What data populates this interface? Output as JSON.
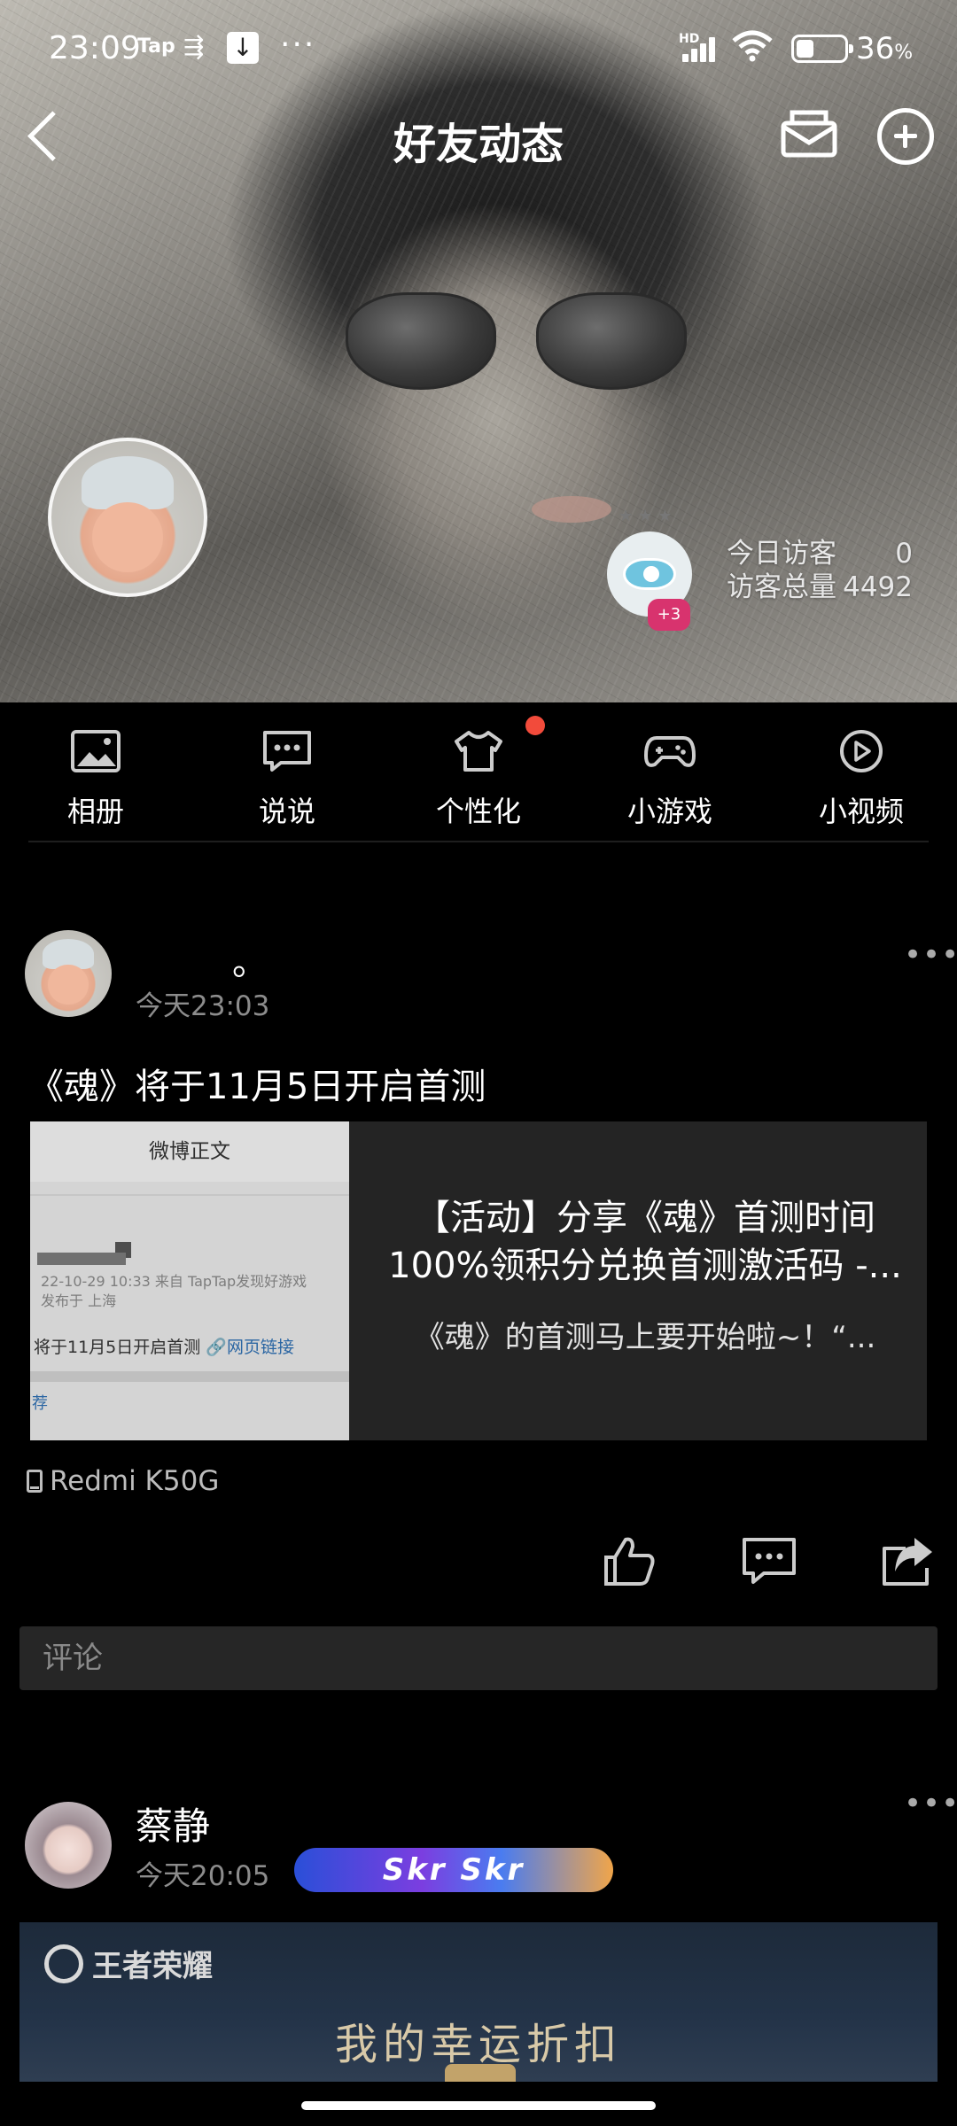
{
  "status_bar": {
    "time": "23:09",
    "tap": "Tap",
    "overflow": "···",
    "network": "HD",
    "battery_pct": "36",
    "battery_unit": "%"
  },
  "nav": {
    "title": "好友动态",
    "icons": [
      "back-icon",
      "mail-icon",
      "add-icon"
    ]
  },
  "visitors": {
    "today_label": "今日访客",
    "today_value": "0",
    "total_label": "访客总量",
    "total_value": "4492",
    "badge": "+3"
  },
  "menu": {
    "items": [
      {
        "label": "相册",
        "icon": "album-icon"
      },
      {
        "label": "说说",
        "icon": "chat-icon"
      },
      {
        "label": "个性化",
        "icon": "tshirt-icon"
      },
      {
        "label": "小游戏",
        "icon": "gamepad-icon"
      },
      {
        "label": "小视频",
        "icon": "play-icon"
      }
    ]
  },
  "post1": {
    "username": "。",
    "time": "今天23:03",
    "text": "《魂》将于11月5日开启首测",
    "thumb": {
      "header": "微博正文",
      "meta_line1": "22-10-29 10:33  来自 TapTap发现好游戏",
      "meta_line2": "发布于 上海",
      "body": "将于11月5日开启首测",
      "link": "🔗网页链接",
      "rec": "荐"
    },
    "card_title": "【活动】分享《魂》首测时间100%领积分兑换首测激活码 -...",
    "card_desc": "《魂》的首测马上要开始啦~！“...",
    "device": "Redmi K50G",
    "comment_placeholder": "评论"
  },
  "post2": {
    "username": "蔡静",
    "time": "今天20:05",
    "badge": "Skr Skr",
    "banner_logo": "王者荣耀",
    "banner_slogan": "我的幸运折扣"
  }
}
